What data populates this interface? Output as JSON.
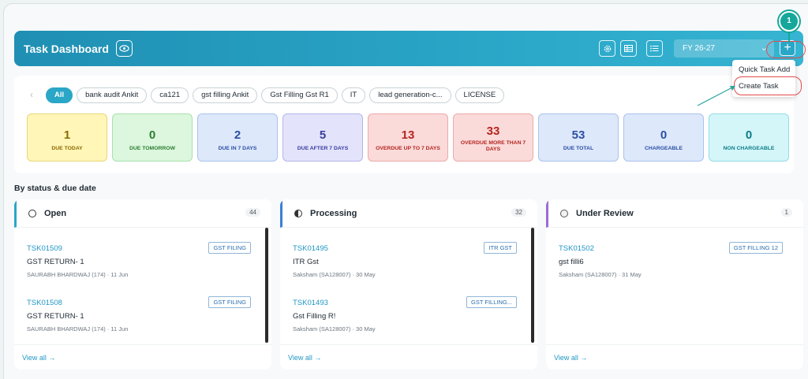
{
  "header": {
    "title": "Task Dashboard",
    "fy": "FY 26-27",
    "step": "1"
  },
  "dropdown": {
    "quick_add": "Quick Task Add",
    "create": "Create Task"
  },
  "chips": [
    {
      "label": "All",
      "active": true
    },
    {
      "label": "bank audit Ankit"
    },
    {
      "label": "ca121"
    },
    {
      "label": "gst filling Ankit"
    },
    {
      "label": "Gst Filling Gst R1"
    },
    {
      "label": "IT"
    },
    {
      "label": "lead generation-c..."
    },
    {
      "label": "LICENSE"
    }
  ],
  "cards": [
    {
      "num": "1",
      "label": "DUE TODAY",
      "bg": "#fff6b8",
      "border": "#e9d77a",
      "color": "#8a6a00"
    },
    {
      "num": "0",
      "label": "DUE TOMORROW",
      "bg": "#dcf7de",
      "border": "#a9e0ae",
      "color": "#2e7d32"
    },
    {
      "num": "2",
      "label": "DUE IN 7 DAYS",
      "bg": "#dde8fb",
      "border": "#a9c2ec",
      "color": "#2c4fa3"
    },
    {
      "num": "5",
      "label": "DUE AFTER 7 DAYS",
      "bg": "#e3e3fb",
      "border": "#b5b5ec",
      "color": "#3b3ba0"
    },
    {
      "num": "13",
      "label": "OVERDUE UP TO 7 DAYS",
      "bg": "#fbdada",
      "border": "#eeaaaa",
      "color": "#b3261e"
    },
    {
      "num": "33",
      "label": "OVERDUE MORE THAN 7 DAYS",
      "bg": "#fbdada",
      "border": "#eeaaaa",
      "color": "#b3261e"
    },
    {
      "num": "53",
      "label": "DUE TOTAL",
      "bg": "#dde8fb",
      "border": "#a9c2ec",
      "color": "#2c4fa3"
    },
    {
      "num": "0",
      "label": "CHARGEABLE",
      "bg": "#dde8fb",
      "border": "#a9c2ec",
      "color": "#2c4fa3"
    },
    {
      "num": "0",
      "label": "NON CHARGEABLE",
      "bg": "#d4f6f9",
      "border": "#94dde4",
      "color": "#0b7c86"
    }
  ],
  "section_title": "By status & due date",
  "columns": [
    {
      "name": "Open",
      "count": "44",
      "accent": "#2aa6c7",
      "tasks": [
        {
          "id": "TSK01509",
          "tag": "GST FILING",
          "title": "GST RETURN- 1",
          "meta": "SAURABH BHARDWAJ (174) · 11 Jun"
        },
        {
          "id": "TSK01508",
          "tag": "GST FILING",
          "title": "GST RETURN- 1",
          "meta": "SAURABH BHARDWAJ (174) · 11 Jun"
        }
      ]
    },
    {
      "name": "Processing",
      "count": "32",
      "accent": "#3b7fd4",
      "tasks": [
        {
          "id": "TSK01495",
          "tag": "ITR GST",
          "title": "ITR Gst",
          "meta": "Saksham (SA128007) · 30 May"
        },
        {
          "id": "TSK01493",
          "tag": "GST FILLING...",
          "title": "Gst Filling R!",
          "meta": "Saksham (SA128007) · 30 May"
        }
      ]
    },
    {
      "name": "Under Review",
      "count": "1",
      "accent": "#9b6bd6",
      "tasks": [
        {
          "id": "TSK01502",
          "tag": "GST FILLING 12",
          "title": "gst filli6",
          "meta": "Saksham (SA128007) · 31 May"
        }
      ]
    }
  ],
  "view_all": "View all →"
}
